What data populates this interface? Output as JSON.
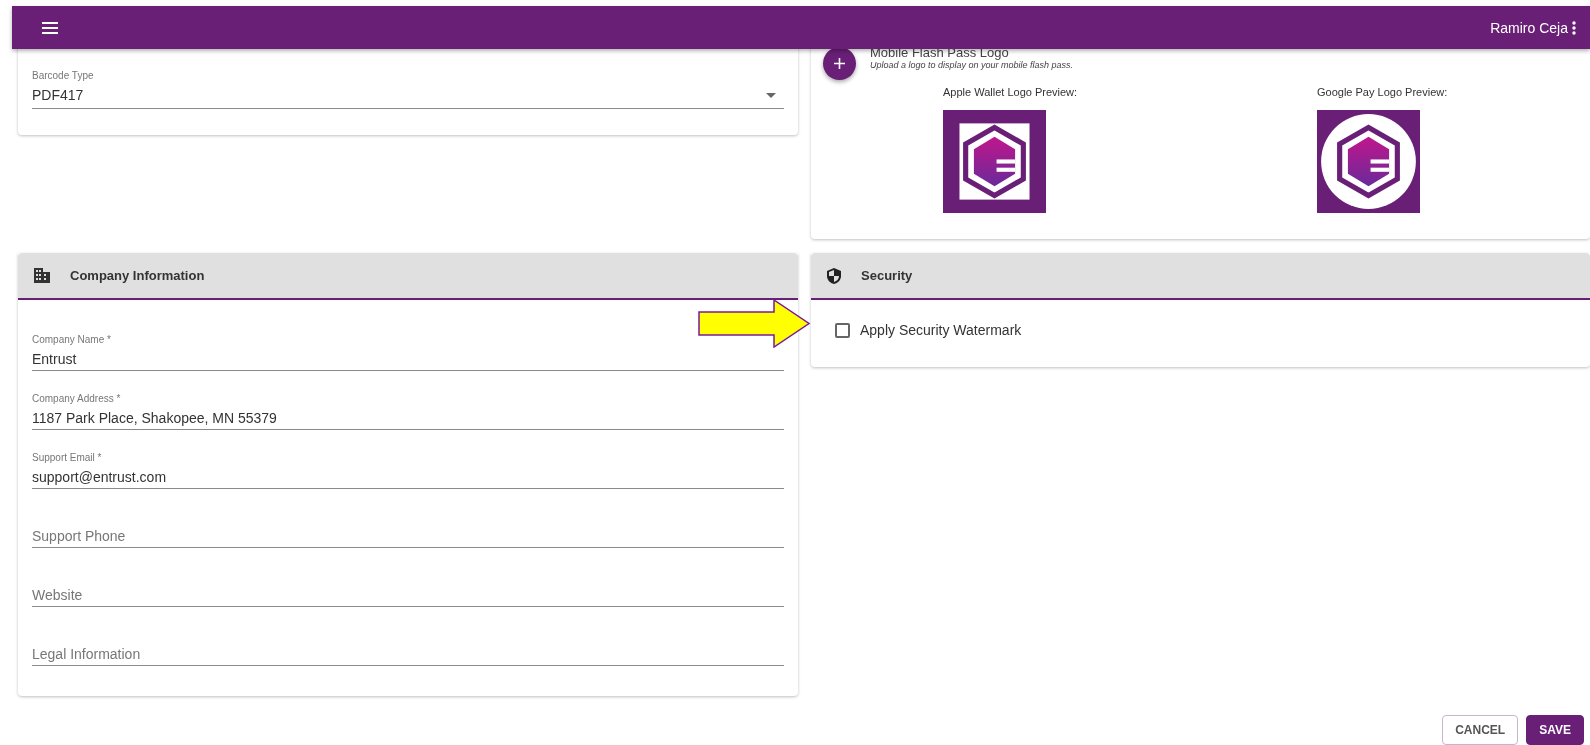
{
  "app_bar": {
    "user_name": "Ramiro Ceja"
  },
  "barcode_card": {
    "field": {
      "label": "Barcode Type",
      "value": "PDF417"
    }
  },
  "logo_card": {
    "title": "Mobile Flash Pass Logo",
    "subtitle": "Upload a logo to display on your mobile flash pass.",
    "previews": [
      {
        "label": "Apple Wallet Logo Preview:",
        "kind": "square"
      },
      {
        "label": "Google Pay Logo Preview:",
        "kind": "circle"
      }
    ]
  },
  "company_card": {
    "title": "Company Information",
    "fields": [
      {
        "label": "Company Name *",
        "value": "Entrust"
      },
      {
        "label": "Company Address *",
        "value": "1187 Park Place, Shakopee, MN 55379"
      },
      {
        "label": "Support Email *",
        "value": "support@entrust.com"
      },
      {
        "placeholder": "Support Phone"
      },
      {
        "placeholder": "Website"
      },
      {
        "placeholder": "Legal Information"
      }
    ]
  },
  "security_card": {
    "title": "Security",
    "checkbox": {
      "label": "Apply Security Watermark",
      "checked": false
    }
  },
  "actions": [
    {
      "label": "CANCEL",
      "kind": "outlined"
    },
    {
      "label": "SAVE",
      "kind": "contained"
    }
  ]
}
